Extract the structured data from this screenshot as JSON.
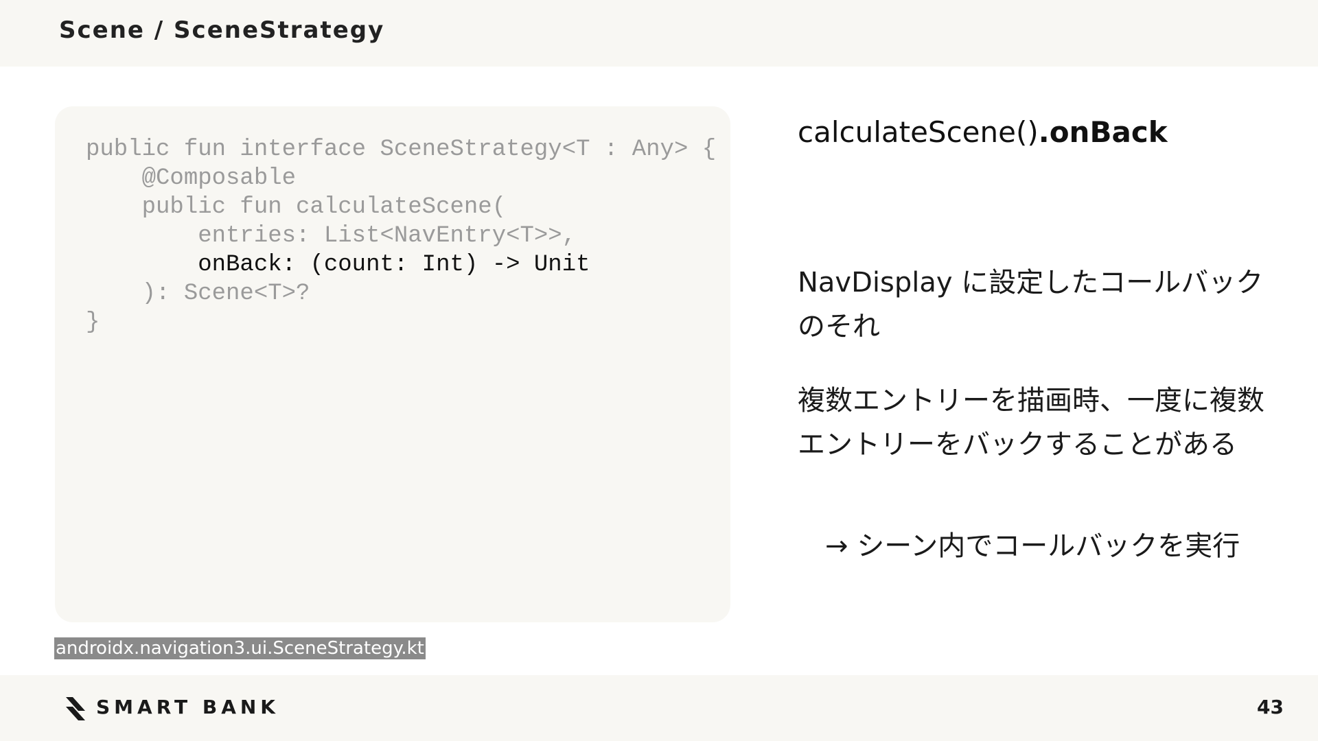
{
  "header": {
    "breadcrumb": "Scene / SceneStrategy"
  },
  "code": {
    "lines": [
      "public fun interface SceneStrategy<T : Any> {",
      "    @Composable",
      "    public fun calculateScene(",
      "        entries: List<NavEntry<T>>,",
      "        onBack: (count: Int) -> Unit",
      "    ): Scene<T>?",
      "}"
    ],
    "highlighted_line": 4,
    "source_caption": "androidx.navigation3.ui.SceneStrategy.kt"
  },
  "explanation": {
    "title_normal": "calculateScene()",
    "title_bold": ".onBack",
    "paragraph1": "NavDisplay に設定したコールバックのそれ",
    "paragraph2": "複数エントリーを描画時、一度に複数エントリーをバックすることがある",
    "paragraph3": "　→ シーン内でコールバックを実行"
  },
  "footer": {
    "logo_text": "SMART BANK",
    "page_number": "43"
  },
  "colors": {
    "panel_background": "#f8f7f3",
    "code_dim": "#9a9a9a",
    "code_highlight": "#111111",
    "caption_background": "#8a8a8a"
  }
}
